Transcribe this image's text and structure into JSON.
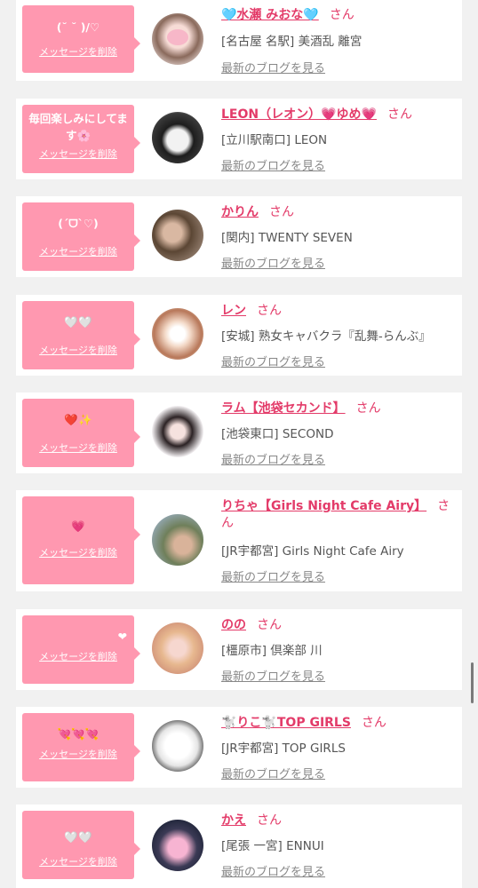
{
  "delete_label": "メッセージを削除",
  "san": "さん",
  "blog_label": "最新のブログを見る",
  "items": [
    {
      "message": "(˘ ˘ )/♡",
      "name": "🩵水瀬 みおな🩵",
      "shop": "[名古屋 名駅] 美酒乱 離宮"
    },
    {
      "message": "毎回楽しみにしてます🌸",
      "name": "LEON（レオン）💗ゆめ💗",
      "shop": "[立川駅南口] LEON"
    },
    {
      "message": "(ˊᗜˋ♡)",
      "name": "かりん",
      "shop": "[関内] TWENTY SEVEN"
    },
    {
      "message": "🤍🤍",
      "name": "レン",
      "shop": "[安城] 熟女キャバクラ『乱舞-らんぶ』"
    },
    {
      "message": "❤️✨",
      "name": "ラム【池袋セカンド】",
      "shop": "[池袋東口] SECOND"
    },
    {
      "message": "💗",
      "name": "りちゃ【Girls Night Cafe Airy】",
      "shop": "[JR宇都宮] Girls Night Cafe Airy"
    },
    {
      "message": "❤",
      "name": "のの",
      "shop": "[橿原市] 倶楽部 川"
    },
    {
      "message": "💘💘💘",
      "name": "🐩りこ🐩TOP GIRLS",
      "shop": "[JR宇都宮] TOP GIRLS"
    },
    {
      "message": "🤍🤍",
      "name": "かえ",
      "shop": "[尾張 一宮] ENNUI"
    }
  ]
}
